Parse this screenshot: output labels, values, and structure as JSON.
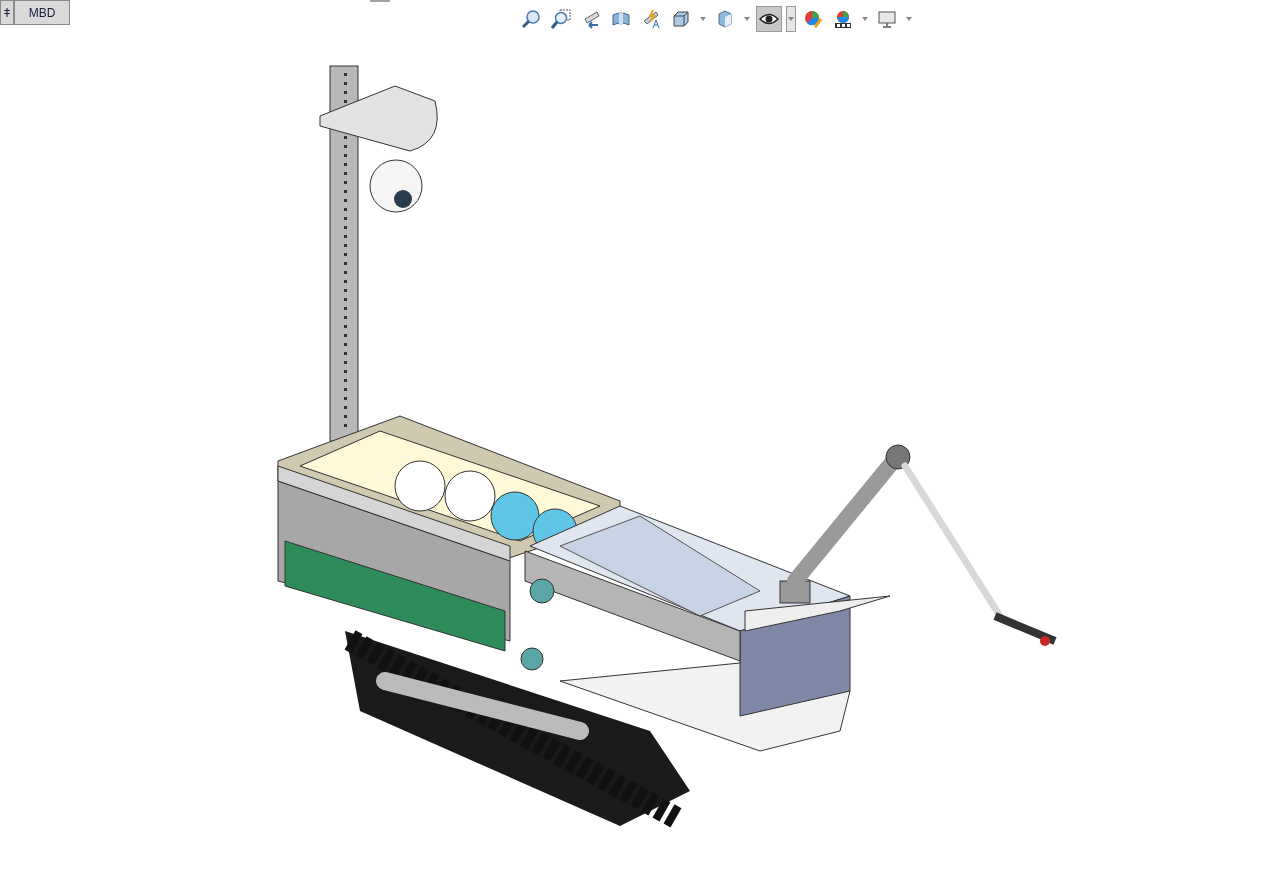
{
  "tabs": [
    {
      "label": "ǂ",
      "selected": false
    },
    {
      "label": "MBD",
      "selected": false
    }
  ],
  "toolbar": [
    {
      "selected": false,
      "dropdown": false
    },
    {
      "selected": false,
      "dropdown": false
    },
    {
      "selected": false,
      "dropdown": false
    },
    {
      "selected": false,
      "dropdown": false
    },
    {
      "selected": false,
      "dropdown": false
    },
    {
      "selected": false,
      "dropdown": true
    },
    {
      "selected": false,
      "dropdown": true
    },
    {
      "selected": true,
      "dropdown": true
    },
    {
      "selected": false,
      "dropdown": false
    },
    {
      "selected": false,
      "dropdown": true
    },
    {
      "selected": false,
      "dropdown": true
    }
  ]
}
